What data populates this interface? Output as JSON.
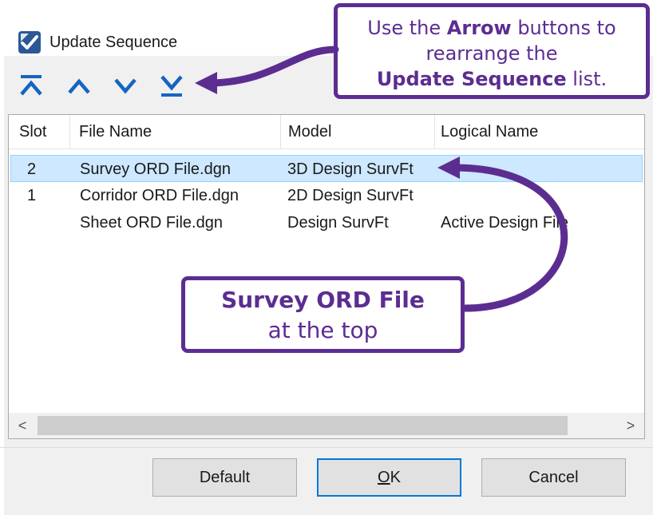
{
  "window": {
    "title": "Update Sequence",
    "icon": "microstation-icon"
  },
  "toolbar": {
    "buttons": [
      {
        "name": "move-to-top",
        "icon": "chevron-double-up-icon"
      },
      {
        "name": "move-up",
        "icon": "chevron-up-icon"
      },
      {
        "name": "move-down",
        "icon": "chevron-down-icon"
      },
      {
        "name": "move-to-bottom",
        "icon": "chevron-double-down-icon"
      }
    ]
  },
  "table": {
    "columns": [
      "Slot",
      "File Name",
      "Model",
      "Logical Name"
    ],
    "rows": [
      {
        "slot": "2",
        "file": "Survey ORD File.dgn",
        "model": "3D Design SurvFt",
        "logical": "",
        "selected": true
      },
      {
        "slot": "1",
        "file": "Corridor ORD File.dgn",
        "model": "2D Design SurvFt",
        "logical": "",
        "selected": false
      },
      {
        "slot": "",
        "file": "Sheet ORD File.dgn",
        "model": "Design SurvFt",
        "logical": "Active Design File",
        "selected": false
      }
    ]
  },
  "scrollbar": {
    "left_arrow": "<",
    "right_arrow": ">"
  },
  "buttons": {
    "default": "Default",
    "ok_mnemonic": "O",
    "ok_rest": "K",
    "cancel": "Cancel"
  },
  "callouts": {
    "top": {
      "line1_pre": "Use the ",
      "line1_bold": "Arrow",
      "line1_post": " buttons to",
      "line2": "rearrange the",
      "line3_bold": "Update Sequence",
      "line3_post": " list."
    },
    "middle": {
      "line1_bold": "Survey ORD File",
      "line2": "at the top"
    }
  },
  "colors": {
    "callout": "#5c2d91",
    "icon_blue": "#1565c0",
    "selection": "#cde8ff",
    "ok_border": "#0078d7"
  }
}
